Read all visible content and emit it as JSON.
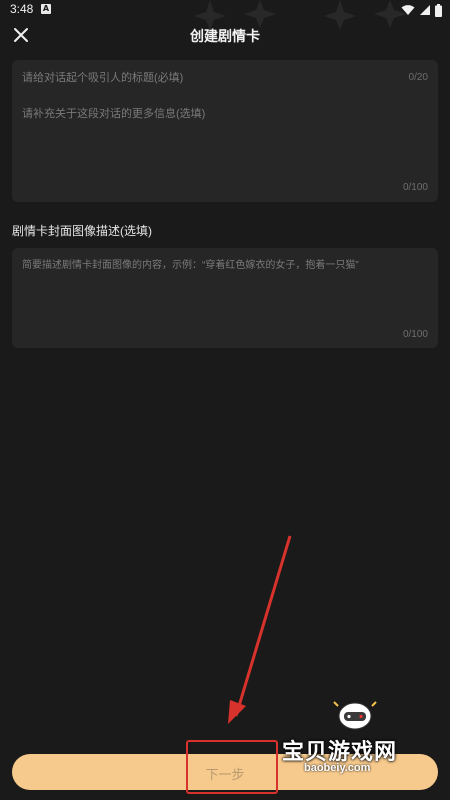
{
  "status_bar": {
    "time": "3:48",
    "badge": "A"
  },
  "header": {
    "title": "创建剧情卡",
    "close_icon": "close-icon"
  },
  "title_field": {
    "placeholder": "请给对话起个吸引人的标题(必填)",
    "counter": "0/20"
  },
  "info_field": {
    "placeholder": "请补充关于这段对话的更多信息(选填)",
    "counter": "0/100"
  },
  "cover_section": {
    "label": "剧情卡封面图像描述(选填)",
    "placeholder": "简要描述剧情卡封面图像的内容，示例：“穿着红色嫁衣的女子，抱着一只猫”",
    "counter": "0/100"
  },
  "next_button": {
    "label": "下一步"
  },
  "watermark": {
    "cn": "宝贝游戏网",
    "url": "baobeiy.com"
  },
  "colors": {
    "background": "#1a1a1a",
    "card": "#262626",
    "button": "#f6c98c",
    "annotation_red": "#d7322c"
  }
}
